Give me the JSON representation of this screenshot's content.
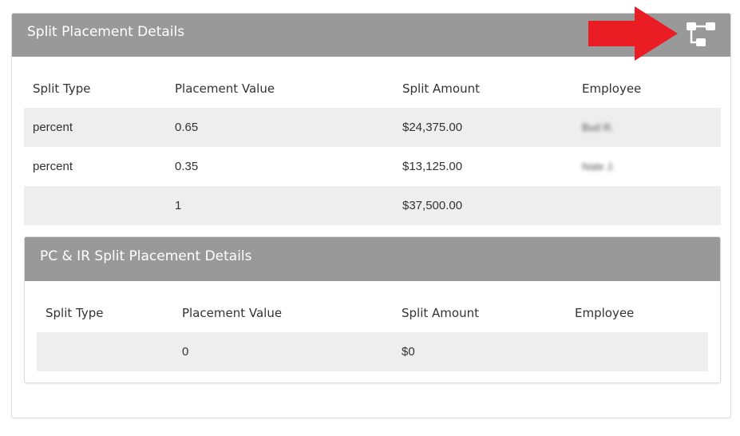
{
  "split_placement": {
    "title": "Split Placement Details",
    "columns": [
      "Split Type",
      "Placement Value",
      "Split Amount",
      "Employee"
    ],
    "rows": [
      {
        "split_type": "percent",
        "placement_value": "0.65",
        "split_amount": "$24,375.00",
        "employee": "Bud R."
      },
      {
        "split_type": "percent",
        "placement_value": "0.35",
        "split_amount": "$13,125.00",
        "employee": "Nate J."
      },
      {
        "split_type": "",
        "placement_value": "1",
        "split_amount": "$37,500.00",
        "employee": ""
      }
    ]
  },
  "pc_ir_split": {
    "title": "PC & IR Split Placement Details",
    "columns": [
      "Split Type",
      "Placement Value",
      "Split Amount",
      "Employee"
    ],
    "rows": [
      {
        "split_type": "",
        "placement_value": "0",
        "split_amount": "$0",
        "employee": ""
      }
    ]
  },
  "header_actions": {
    "icon": "hierarchy-tree-icon"
  },
  "colors": {
    "header_bg": "#999999",
    "stripe_bg": "#eeeeee",
    "arrow": "#ea1c24"
  }
}
